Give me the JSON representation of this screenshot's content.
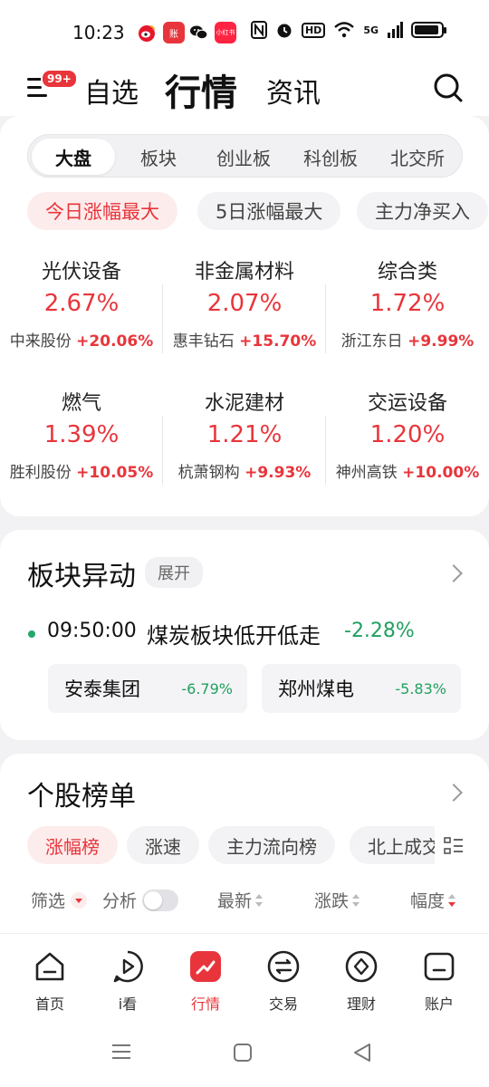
{
  "status_bar": {
    "time": "10:23",
    "apps": [
      "weibo-app-icon",
      "zhang-app-icon",
      "wechat-icon",
      "xiaohongshu-app-icon"
    ],
    "zhang_label": "账",
    "xhs_label": "小红书",
    "hd_label": "HD",
    "signal_label": "5G"
  },
  "header": {
    "badge": "99+",
    "tabs": [
      "自选",
      "行情",
      "资讯"
    ]
  },
  "segment": {
    "items": [
      "大盘",
      "板块",
      "创业板",
      "科创板",
      "北交所"
    ],
    "active_index": 0
  },
  "filter_chips": [
    "今日涨幅最大",
    "5日涨幅最大",
    "主力净买入"
  ],
  "sectors": [
    {
      "name": "光伏设备",
      "pct": "2.67%",
      "lead_stock": "中来股份",
      "lead_pct": "+20.06%"
    },
    {
      "name": "非金属材料",
      "pct": "2.07%",
      "lead_stock": "惠丰钻石",
      "lead_pct": "+15.70%"
    },
    {
      "name": "综合类",
      "pct": "1.72%",
      "lead_stock": "浙江东日",
      "lead_pct": "+9.99%"
    },
    {
      "name": "燃气",
      "pct": "1.39%",
      "lead_stock": "胜利股份",
      "lead_pct": "+10.05%"
    },
    {
      "name": "水泥建材",
      "pct": "1.21%",
      "lead_stock": "杭萧钢构",
      "lead_pct": "+9.93%"
    },
    {
      "name": "交运设备",
      "pct": "1.20%",
      "lead_stock": "神州高铁",
      "lead_pct": "+10.00%"
    }
  ],
  "sector_movement": {
    "title": "板块异动",
    "expand_label": "展开",
    "event": {
      "time": "09:50:00",
      "text": "煤炭板块低开低走",
      "pct": "-2.28%"
    },
    "stocks": [
      {
        "name": "安泰集团",
        "pct": "-6.79%"
      },
      {
        "name": "郑州煤电",
        "pct": "-5.83%"
      }
    ]
  },
  "stock_ranking": {
    "title": "个股榜单",
    "tabs": [
      "涨幅榜",
      "涨速",
      "主力流向榜",
      "北上成交"
    ],
    "columns": {
      "filter": "筛选",
      "analysis": "分析",
      "latest": "最新",
      "change": "涨跌",
      "range": "幅度"
    }
  },
  "bottom_nav": {
    "items": [
      "首页",
      "i看",
      "行情",
      "交易",
      "理财",
      "账户"
    ],
    "active_index": 2
  },
  "colors": {
    "accent": "#e8353b",
    "down": "#20a060"
  }
}
